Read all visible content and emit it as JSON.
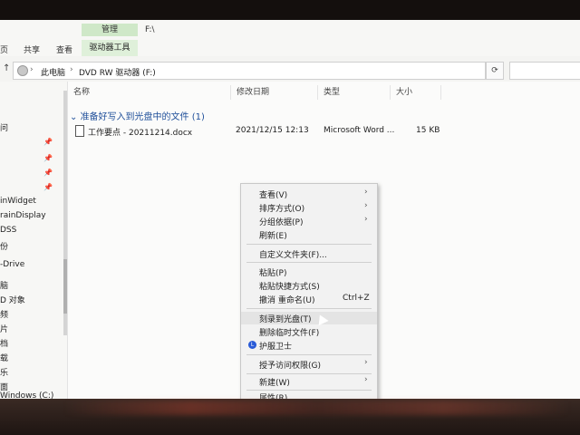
{
  "window": {
    "path_title": "F:\\"
  },
  "ribbon": {
    "context_group": "管理",
    "tabs": [
      {
        "label": "页"
      },
      {
        "label": "共享"
      },
      {
        "label": "查看"
      }
    ],
    "context_tab": "驱动器工具"
  },
  "address": {
    "segments": [
      "此电脑",
      "DVD RW 驱动器 (F:)"
    ],
    "refresh_icon": "refresh-icon"
  },
  "nav": {
    "items": [
      {
        "label": "问"
      },
      {
        "label": ""
      },
      {
        "label": ""
      },
      {
        "label": ""
      },
      {
        "label": "inWidget"
      },
      {
        "label": "rainDisplay"
      },
      {
        "label": "DSS"
      },
      {
        "label": "份"
      },
      {
        "label": "-Drive"
      },
      {
        "label": "脑"
      },
      {
        "label": "D 对象"
      },
      {
        "label": "频"
      },
      {
        "label": "片"
      },
      {
        "label": "档"
      },
      {
        "label": "载"
      },
      {
        "label": "乐"
      },
      {
        "label": "面"
      },
      {
        "label": "Windows (C:)"
      },
      {
        "label": "目"
      }
    ]
  },
  "columns": [
    {
      "label": "名称"
    },
    {
      "label": "修改日期"
    },
    {
      "label": "类型"
    },
    {
      "label": "大小"
    }
  ],
  "group": {
    "title": "准备好写入到光盘中的文件 (1)"
  },
  "files": [
    {
      "name": "工作要点 - 20211214.docx",
      "modified": "2021/12/15 12:13",
      "type": "Microsoft Word ...",
      "size": "15 KB"
    }
  ],
  "context_menu": {
    "items": [
      {
        "label": "查看(V)",
        "submenu": true
      },
      {
        "label": "排序方式(O)",
        "submenu": true
      },
      {
        "label": "分组依据(P)",
        "submenu": true
      },
      {
        "label": "刷新(E)"
      },
      {
        "label": "自定义文件夹(F)..."
      },
      {
        "label": "粘贴(P)"
      },
      {
        "label": "粘贴快捷方式(S)"
      },
      {
        "label": "撤消 重命名(U)",
        "shortcut": "Ctrl+Z"
      },
      {
        "label": "刻录到光盘(T)"
      },
      {
        "label": "删除临时文件(F)"
      },
      {
        "label": "护服卫士",
        "icon": "shield-icon"
      },
      {
        "label": "授予访问权限(G)",
        "submenu": true
      },
      {
        "label": "新建(W)",
        "submenu": true
      },
      {
        "label": "属性(R)"
      }
    ]
  }
}
